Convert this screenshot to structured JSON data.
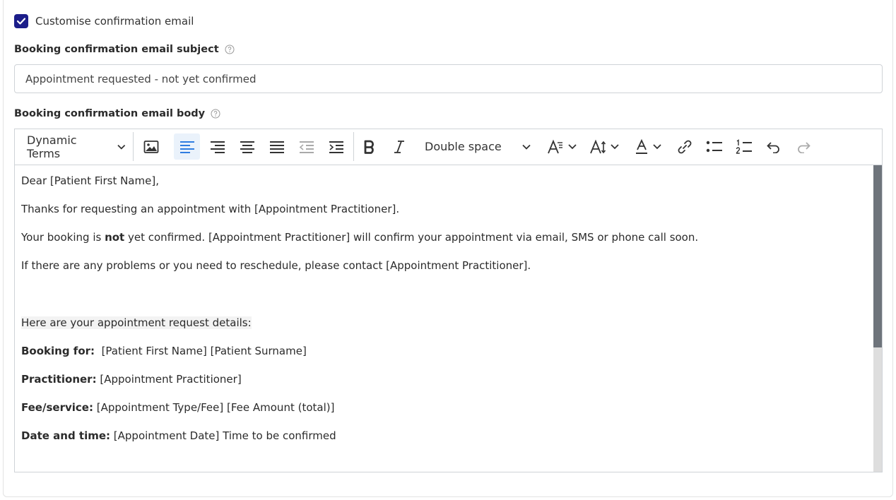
{
  "customise": {
    "label": "Customise confirmation email",
    "checked": true
  },
  "subject": {
    "label": "Booking confirmation email subject",
    "value": "Appointment requested - not yet confirmed"
  },
  "body": {
    "label": "Booking confirmation email body",
    "toolbar": {
      "dynamic_terms": "Dynamic Terms",
      "line_spacing": "Double space"
    },
    "paragraphs": {
      "greeting": "Dear [Patient First Name],",
      "thanks": "Thanks for requesting an appointment with [Appointment Practitioner].",
      "status_pre": "Your booking is ",
      "status_bold": "not",
      "status_post": " yet confirmed. [Appointment Practitioner] will confirm your appointment via email, SMS or phone call soon.",
      "problems": "If there are any problems or you need to reschedule, please contact [Appointment Practitioner].",
      "details_intro": "Here are your appointment request details:",
      "booking_for_label": "Booking for:",
      "booking_for_value": "  [Patient First Name] [Patient Surname]",
      "practitioner_label": "Practitioner:",
      "practitioner_value": " [Appointment Practitioner]",
      "fee_label": "Fee/service:",
      "fee_value": " [Appointment Type/Fee] [Fee Amount (total)]",
      "date_label": "Date and time:",
      "date_value": " [Appointment Date] Time to be confirmed"
    }
  },
  "colors": {
    "checkbox": "#1c1e8a",
    "active_tool": "#2f7de1",
    "scroll_thumb": "#6e747b"
  }
}
